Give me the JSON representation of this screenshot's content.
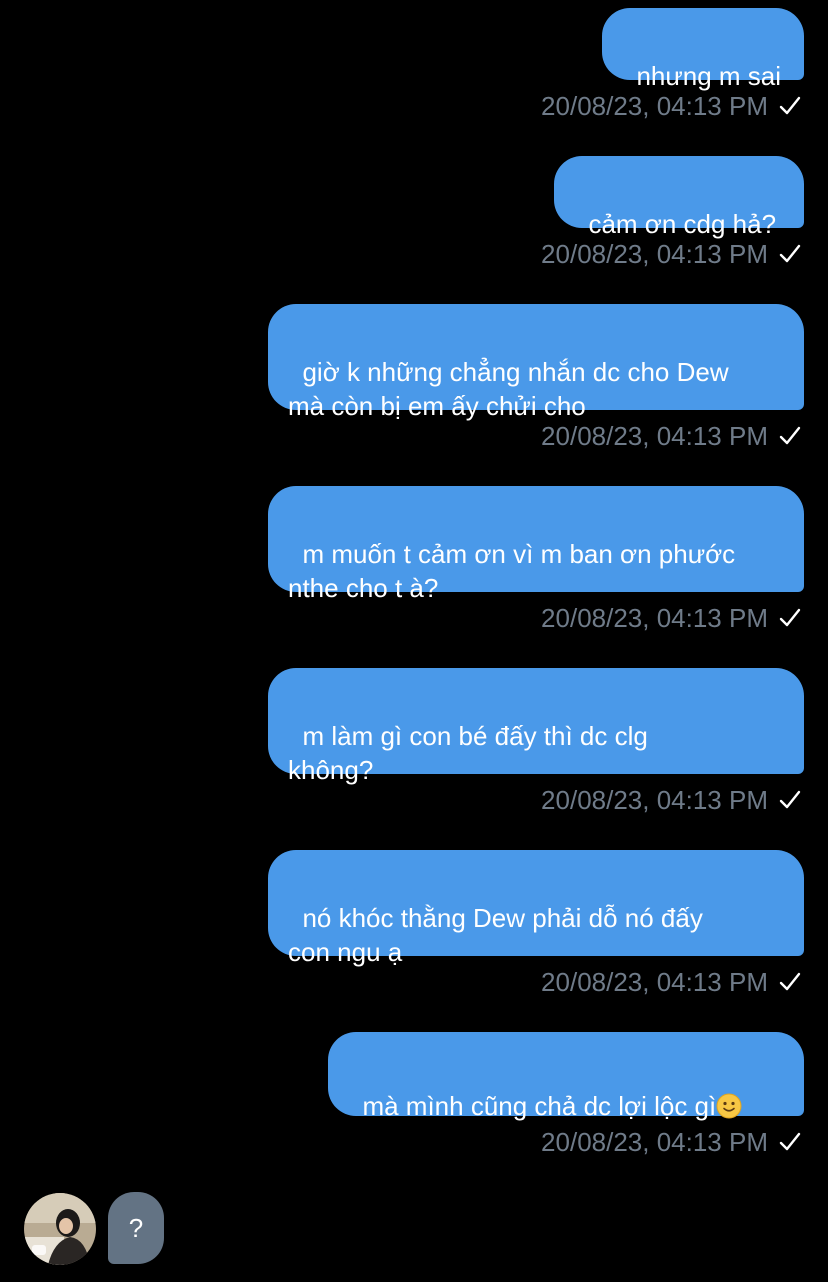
{
  "messages": [
    {
      "text": "nhưng m sai",
      "time": "20/08/23, 04:13 PM"
    },
    {
      "text": "cảm ơn cdg hả?",
      "time": "20/08/23, 04:13 PM"
    },
    {
      "text": "giờ k những chẳng nhắn dc cho Dew\nmà còn bị em ấy chửi cho",
      "time": "20/08/23, 04:13 PM"
    },
    {
      "text": "m muốn t cảm ơn vì m ban ơn phước\nnthe cho t à?",
      "time": "20/08/23, 04:13 PM"
    },
    {
      "text": "m làm gì con bé đấy thì dc clg\nkhông?",
      "time": "20/08/23, 04:13 PM"
    },
    {
      "text": "nó khóc thằng Dew phải dỗ nó đấy\ncon ngu ạ",
      "time": "20/08/23, 04:13 PM"
    },
    {
      "text": "mà mình cũng chả dc lợi lộc gì",
      "emoji": "slightly-smiling-face",
      "time": "20/08/23, 04:13 PM"
    }
  ],
  "incoming": {
    "text": "?",
    "avatar": "contact-avatar"
  },
  "colors": {
    "background": "#000000",
    "outgoing_bubble": "#4a99e9",
    "incoming_bubble": "#637384",
    "timestamp": "#6f7b89"
  }
}
